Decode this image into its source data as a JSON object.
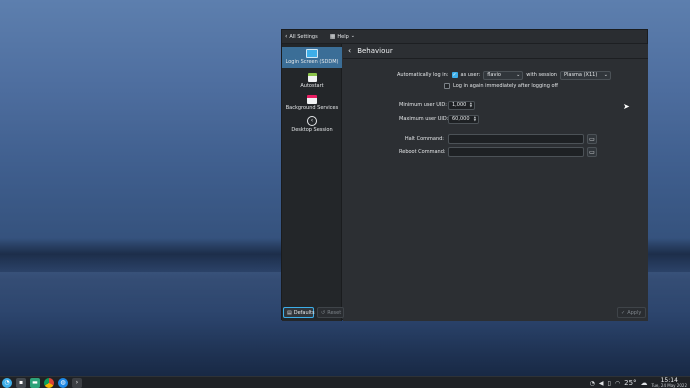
{
  "titlebar": {
    "all_settings": "All Settings",
    "help": "Help"
  },
  "sidebar": {
    "items": [
      {
        "label": "Login Screen (SDDM)",
        "icon": "monitor-icon",
        "color": "#3daee9"
      },
      {
        "label": "Autostart",
        "icon": "autostart-icon",
        "color": "#8bc34a"
      },
      {
        "label": "Background Services",
        "icon": "services-icon",
        "color": "#e91e63"
      },
      {
        "label": "Desktop Session",
        "icon": "desktop-session-icon",
        "color": "#e6e8ea"
      }
    ]
  },
  "page": {
    "title": "Behaviour"
  },
  "form": {
    "autologin_label": "Automatically log in:",
    "as_user_label": "as user:",
    "user_value": "flavio",
    "with_session_label": "with session",
    "session_value": "Plasma (X11)",
    "relogin_label": "Log in again immediately after logging off",
    "min_uid_label": "Minimum user UID:",
    "min_uid_value": "1,000",
    "max_uid_label": "Maximum user UID:",
    "max_uid_value": "60,000",
    "halt_label": "Halt Command:",
    "halt_value": "",
    "reboot_label": "Reboot Command:",
    "reboot_value": ""
  },
  "footer": {
    "defaults": "Defaults",
    "reset": "Reset",
    "apply": "Apply"
  },
  "taskbar": {
    "temperature": "25°",
    "time": "15:14",
    "date": "Tue, 24 May 2022"
  },
  "colors": {
    "accent": "#3daee9",
    "selection": "#3b6e97",
    "window_bg": "#2c2f33"
  }
}
